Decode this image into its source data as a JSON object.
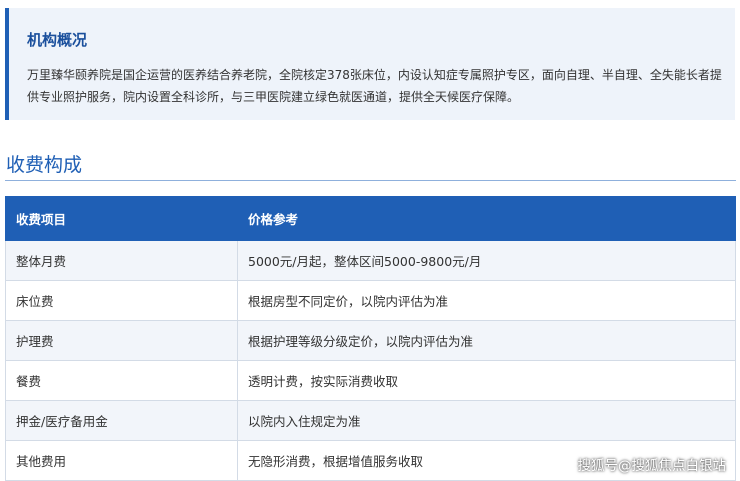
{
  "overview": {
    "title": "机构概况",
    "text": "万里臻华颐养院是国企运营的医养结合养老院，全院核定378张床位，内设认知症专属照护专区，面向自理、半自理、全失能长者提供专业照护服务，院内设置全科诊所，与三甲医院建立绿色就医通道，提供全天候医疗保障。"
  },
  "fees": {
    "title": "收费构成",
    "headers": [
      "收费项目",
      "价格参考"
    ],
    "rows": [
      [
        "整体月费",
        "5000元/月起，整体区间5000-9800元/月"
      ],
      [
        "床位费",
        "根据房型不同定价，以院内评估为准"
      ],
      [
        "护理费",
        "根据护理等级分级定价，以院内评估为准"
      ],
      [
        "餐费",
        "透明计费，按实际消费收取"
      ],
      [
        "押金/医疗备用金",
        "以院内入住规定为准"
      ],
      [
        "其他费用",
        "无隐形消费，根据增值服务收取"
      ]
    ]
  },
  "watermark": "搜狐号@搜狐焦点白银站",
  "colors": {
    "accent": "#1f5fb5",
    "title": "#1a4f9c",
    "info_bg": "#eef3fa",
    "row_alt": "#f2f5fa"
  }
}
